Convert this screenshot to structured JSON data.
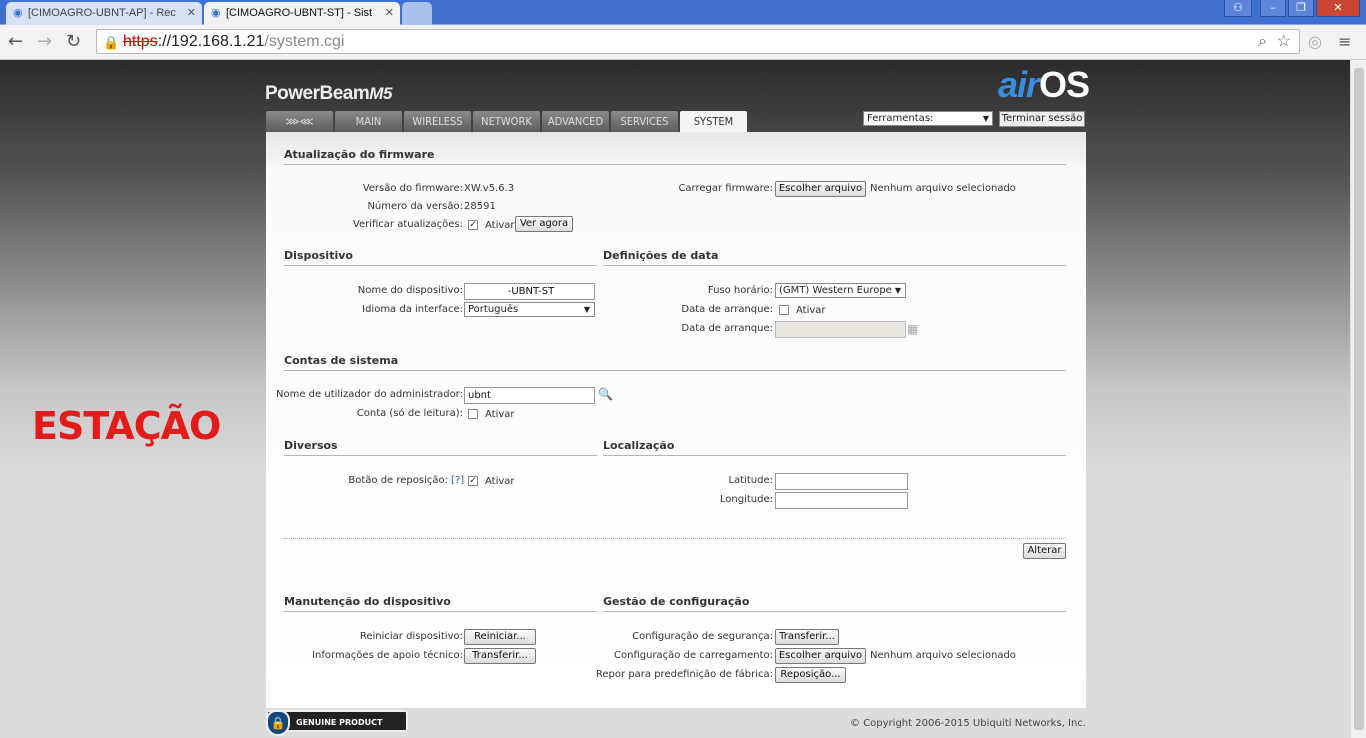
{
  "browser": {
    "tabs": [
      {
        "label": "[CIMOAGRO-UBNT-AP] - Rec"
      },
      {
        "label": "[CIMOAGRO-UBNT-ST] - Sist"
      }
    ],
    "address": {
      "scheme": "https",
      "host": "://192.168.1.21",
      "path": "/system.cgi"
    }
  },
  "overlay": {
    "station_label": "ESTAÇÃO",
    "color": "#e31b1b"
  },
  "header": {
    "product": "PowerBeam",
    "model": "M5",
    "logo_air": "air",
    "logo_os": "OS",
    "tabs": [
      "MAIN",
      "WIRELESS",
      "NETWORK",
      "ADVANCED",
      "SERVICES",
      "SYSTEM"
    ],
    "active_tab": "SYSTEM",
    "tools_select": "Ferramentas:",
    "logout": "Terminar sessão"
  },
  "firmware": {
    "title": "Atualização do firmware",
    "version_label": "Versão do firmware:",
    "version_value": "XW.v5.6.3",
    "build_label": "Número da versão:",
    "build_value": "28591",
    "check_label": "Verificar atualizações:",
    "check_enable": "Ativar",
    "check_now": "Ver agora",
    "upload_label": "Carregar firmware:",
    "choose_file": "Escolher arquivo",
    "no_file": "Nenhum arquivo selecionado"
  },
  "device": {
    "title": "Dispositivo",
    "name_label": "Nome do dispositivo:",
    "name_value": "-UBNT-ST",
    "lang_label": "Idioma da interface:",
    "lang_value": "Português"
  },
  "date": {
    "title": "Definições de data",
    "tz_label": "Fuso horário:",
    "tz_value": "(GMT) Western Europe",
    "startup_label": "Data de arranque:",
    "startup_enable": "Ativar",
    "startup_date_label": "Data de arranque:"
  },
  "accounts": {
    "title": "Contas de sistema",
    "admin_label": "Nome de utilizador do administrador:",
    "admin_value": "ubnt",
    "readonly_label": "Conta (só de leitura):",
    "readonly_enable": "Ativar"
  },
  "misc": {
    "title": "Diversos",
    "reset_label": "Botão de reposição:",
    "reset_help": "[?]",
    "reset_enable": "Ativar"
  },
  "location": {
    "title": "Localização",
    "lat_label": "Latitude:",
    "lon_label": "Longitude:"
  },
  "change_button": "Alterar",
  "maintenance": {
    "title": "Manutenção do dispositivo",
    "reboot_label": "Reiniciar dispositivo:",
    "reboot_button": "Reiniciar...",
    "support_label": "Informações de apoio técnico:",
    "support_button": "Transferir..."
  },
  "config": {
    "title": "Gestão de configuração",
    "backup_label": "Configuração de segurança:",
    "backup_button": "Transferir...",
    "upload_label": "Configuração de carregamento:",
    "choose_file": "Escolher arquivo",
    "no_file": "Nenhum arquivo selecionado",
    "reset_label": "Repor para predefinição de fábrica:",
    "reset_button": "Reposição..."
  },
  "footer": {
    "genuine": "GENUINE    PRODUCT",
    "copyright": "© Copyright 2006-2015 Ubiquiti Networks, Inc."
  }
}
